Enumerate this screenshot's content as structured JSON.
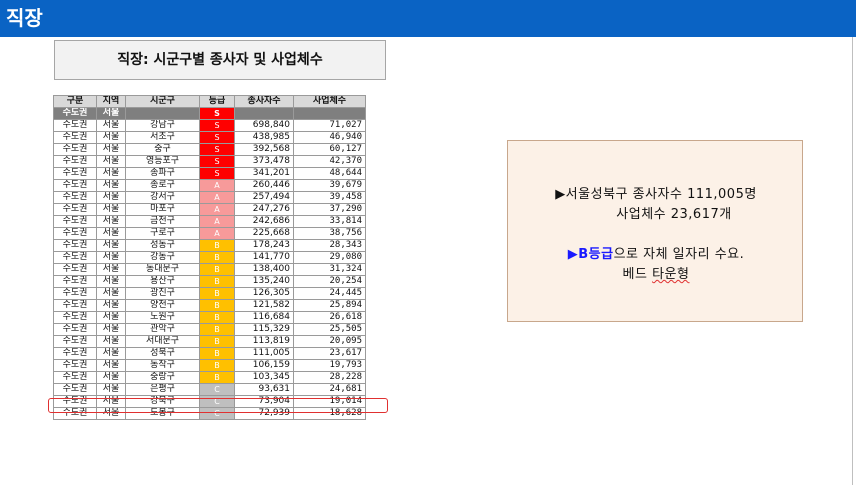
{
  "header": {
    "title": "직장"
  },
  "table_title": "직장: 시군구별 종사자 및 사업체수",
  "columns": [
    "구분",
    "지역",
    "시군구",
    "등급",
    "종사자수",
    "사업체수"
  ],
  "region_row": {
    "gu": "수도권",
    "region": "서울",
    "sgg": "",
    "grade": "S",
    "employees": "",
    "businesses": ""
  },
  "rows": [
    {
      "gu": "수도권",
      "region": "서울",
      "sgg": "강남구",
      "grade": "S",
      "employees": "698,840",
      "businesses": "71,027"
    },
    {
      "gu": "수도권",
      "region": "서울",
      "sgg": "서초구",
      "grade": "S",
      "employees": "438,985",
      "businesses": "46,940"
    },
    {
      "gu": "수도권",
      "region": "서울",
      "sgg": "중구",
      "grade": "S",
      "employees": "392,568",
      "businesses": "60,127"
    },
    {
      "gu": "수도권",
      "region": "서울",
      "sgg": "영등포구",
      "grade": "S",
      "employees": "373,478",
      "businesses": "42,370"
    },
    {
      "gu": "수도권",
      "region": "서울",
      "sgg": "송파구",
      "grade": "S",
      "employees": "341,201",
      "businesses": "48,644"
    },
    {
      "gu": "수도권",
      "region": "서울",
      "sgg": "종로구",
      "grade": "A",
      "employees": "260,446",
      "businesses": "39,679"
    },
    {
      "gu": "수도권",
      "region": "서울",
      "sgg": "강서구",
      "grade": "A",
      "employees": "257,494",
      "businesses": "39,458"
    },
    {
      "gu": "수도권",
      "region": "서울",
      "sgg": "마포구",
      "grade": "A",
      "employees": "247,276",
      "businesses": "37,290"
    },
    {
      "gu": "수도권",
      "region": "서울",
      "sgg": "금천구",
      "grade": "A",
      "employees": "242,686",
      "businesses": "33,814"
    },
    {
      "gu": "수도권",
      "region": "서울",
      "sgg": "구로구",
      "grade": "A",
      "employees": "225,668",
      "businesses": "38,756"
    },
    {
      "gu": "수도권",
      "region": "서울",
      "sgg": "성동구",
      "grade": "B",
      "employees": "178,243",
      "businesses": "28,343"
    },
    {
      "gu": "수도권",
      "region": "서울",
      "sgg": "강동구",
      "grade": "B",
      "employees": "141,770",
      "businesses": "29,080"
    },
    {
      "gu": "수도권",
      "region": "서울",
      "sgg": "동대문구",
      "grade": "B",
      "employees": "138,400",
      "businesses": "31,324"
    },
    {
      "gu": "수도권",
      "region": "서울",
      "sgg": "용산구",
      "grade": "B",
      "employees": "135,240",
      "businesses": "20,254"
    },
    {
      "gu": "수도권",
      "region": "서울",
      "sgg": "광진구",
      "grade": "B",
      "employees": "126,305",
      "businesses": "24,445"
    },
    {
      "gu": "수도권",
      "region": "서울",
      "sgg": "양천구",
      "grade": "B",
      "employees": "121,582",
      "businesses": "25,894"
    },
    {
      "gu": "수도권",
      "region": "서울",
      "sgg": "노원구",
      "grade": "B",
      "employees": "116,684",
      "businesses": "26,618"
    },
    {
      "gu": "수도권",
      "region": "서울",
      "sgg": "관악구",
      "grade": "B",
      "employees": "115,329",
      "businesses": "25,505"
    },
    {
      "gu": "수도권",
      "region": "서울",
      "sgg": "서대문구",
      "grade": "B",
      "employees": "113,819",
      "businesses": "20,095"
    },
    {
      "gu": "수도권",
      "region": "서울",
      "sgg": "성북구",
      "grade": "B",
      "employees": "111,005",
      "businesses": "23,617"
    },
    {
      "gu": "수도권",
      "region": "서울",
      "sgg": "동작구",
      "grade": "B",
      "employees": "106,159",
      "businesses": "19,793"
    },
    {
      "gu": "수도권",
      "region": "서울",
      "sgg": "중랑구",
      "grade": "B",
      "employees": "103,345",
      "businesses": "28,228"
    },
    {
      "gu": "수도권",
      "region": "서울",
      "sgg": "은평구",
      "grade": "C",
      "employees": "93,631",
      "businesses": "24,681"
    },
    {
      "gu": "수도권",
      "region": "서울",
      "sgg": "강북구",
      "grade": "C",
      "employees": "73,904",
      "businesses": "19,014"
    },
    {
      "gu": "수도권",
      "region": "서울",
      "sgg": "도봉구",
      "grade": "C",
      "employees": "72,939",
      "businesses": "18,628"
    }
  ],
  "grade_colors": {
    "S": "#ff0000",
    "A": "#f79a9a",
    "B": "#ffc000",
    "C": "#bfbfbf"
  },
  "note": {
    "line1": "▶서울성북구 종사자수 111,005명",
    "line2": "사업체수 23,617개",
    "line3_emph": "▶B등급",
    "line3_rest": "으로 자체 일자리 수요.",
    "line4_a": "베드 ",
    "line4_b": "타운형"
  }
}
